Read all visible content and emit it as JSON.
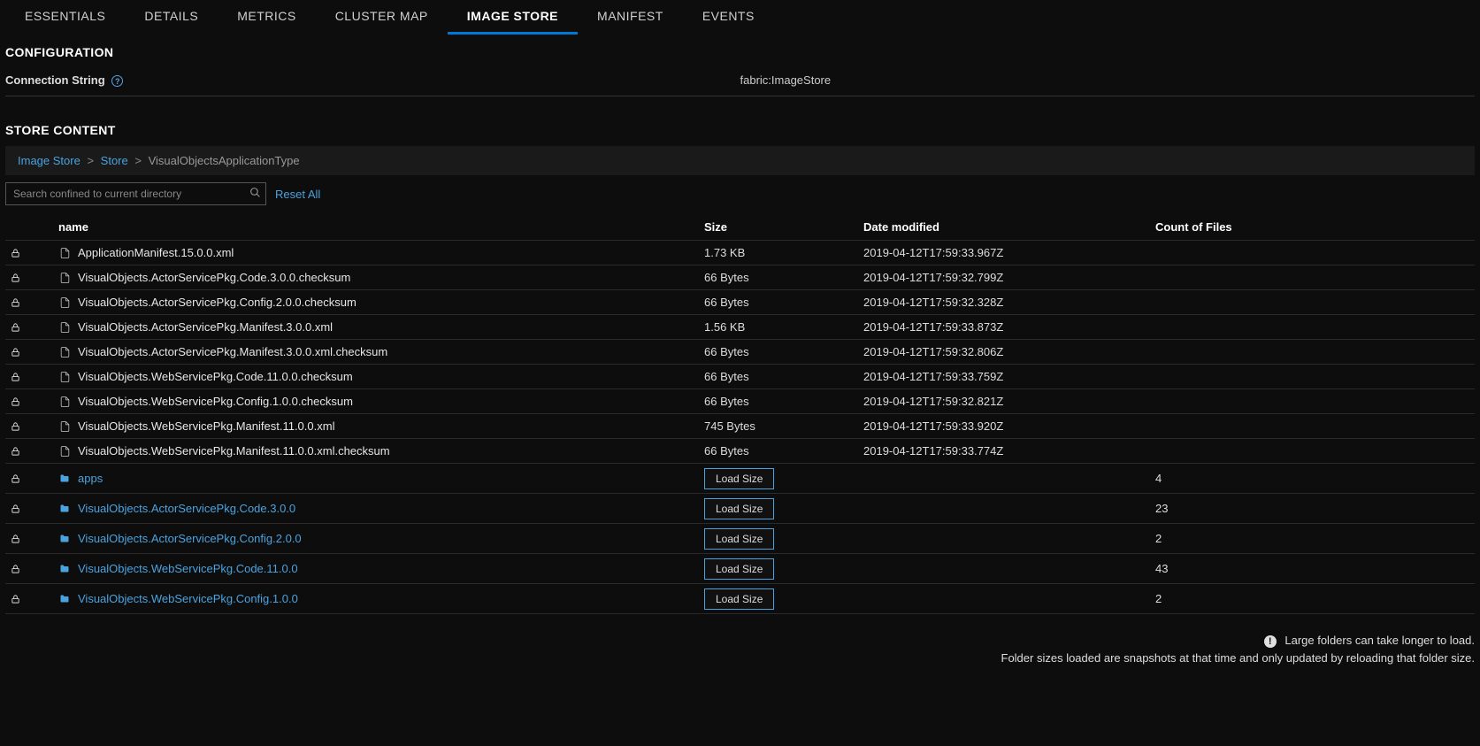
{
  "tabs": [
    {
      "label": "ESSENTIALS",
      "active": false
    },
    {
      "label": "DETAILS",
      "active": false
    },
    {
      "label": "METRICS",
      "active": false
    },
    {
      "label": "CLUSTER MAP",
      "active": false
    },
    {
      "label": "IMAGE STORE",
      "active": true
    },
    {
      "label": "MANIFEST",
      "active": false
    },
    {
      "label": "EVENTS",
      "active": false
    }
  ],
  "sections": {
    "configuration_title": "CONFIGURATION",
    "store_content_title": "STORE CONTENT"
  },
  "config": {
    "connection_string_label": "Connection String",
    "connection_string_value": "fabric:ImageStore"
  },
  "breadcrumb": {
    "root": "Image Store",
    "store": "Store",
    "current": "VisualObjectsApplicationType",
    "sep": ">"
  },
  "search": {
    "placeholder": "Search confined to current directory",
    "reset_label": "Reset All"
  },
  "table": {
    "headers": {
      "name": "name",
      "size": "Size",
      "date": "Date modified",
      "count": "Count of Files"
    },
    "load_size_label": "Load Size",
    "rows": [
      {
        "type": "file",
        "name": "ApplicationManifest.15.0.0.xml",
        "size": "1.73 KB",
        "date": "2019-04-12T17:59:33.967Z",
        "count": ""
      },
      {
        "type": "file",
        "name": "VisualObjects.ActorServicePkg.Code.3.0.0.checksum",
        "size": "66 Bytes",
        "date": "2019-04-12T17:59:32.799Z",
        "count": ""
      },
      {
        "type": "file",
        "name": "VisualObjects.ActorServicePkg.Config.2.0.0.checksum",
        "size": "66 Bytes",
        "date": "2019-04-12T17:59:32.328Z",
        "count": ""
      },
      {
        "type": "file",
        "name": "VisualObjects.ActorServicePkg.Manifest.3.0.0.xml",
        "size": "1.56 KB",
        "date": "2019-04-12T17:59:33.873Z",
        "count": ""
      },
      {
        "type": "file",
        "name": "VisualObjects.ActorServicePkg.Manifest.3.0.0.xml.checksum",
        "size": "66 Bytes",
        "date": "2019-04-12T17:59:32.806Z",
        "count": ""
      },
      {
        "type": "file",
        "name": "VisualObjects.WebServicePkg.Code.11.0.0.checksum",
        "size": "66 Bytes",
        "date": "2019-04-12T17:59:33.759Z",
        "count": ""
      },
      {
        "type": "file",
        "name": "VisualObjects.WebServicePkg.Config.1.0.0.checksum",
        "size": "66 Bytes",
        "date": "2019-04-12T17:59:32.821Z",
        "count": ""
      },
      {
        "type": "file",
        "name": "VisualObjects.WebServicePkg.Manifest.11.0.0.xml",
        "size": "745 Bytes",
        "date": "2019-04-12T17:59:33.920Z",
        "count": ""
      },
      {
        "type": "file",
        "name": "VisualObjects.WebServicePkg.Manifest.11.0.0.xml.checksum",
        "size": "66 Bytes",
        "date": "2019-04-12T17:59:33.774Z",
        "count": ""
      },
      {
        "type": "folder",
        "name": "apps",
        "size": "",
        "date": "",
        "count": "4"
      },
      {
        "type": "folder",
        "name": "VisualObjects.ActorServicePkg.Code.3.0.0",
        "size": "",
        "date": "",
        "count": "23"
      },
      {
        "type": "folder",
        "name": "VisualObjects.ActorServicePkg.Config.2.0.0",
        "size": "",
        "date": "",
        "count": "2"
      },
      {
        "type": "folder",
        "name": "VisualObjects.WebServicePkg.Code.11.0.0",
        "size": "",
        "date": "",
        "count": "43"
      },
      {
        "type": "folder",
        "name": "VisualObjects.WebServicePkg.Config.1.0.0",
        "size": "",
        "date": "",
        "count": "2"
      }
    ]
  },
  "footer": {
    "line1": "Large folders can take longer to load.",
    "line2": "Folder sizes loaded are snapshots at that time and only updated by reloading that folder size."
  }
}
